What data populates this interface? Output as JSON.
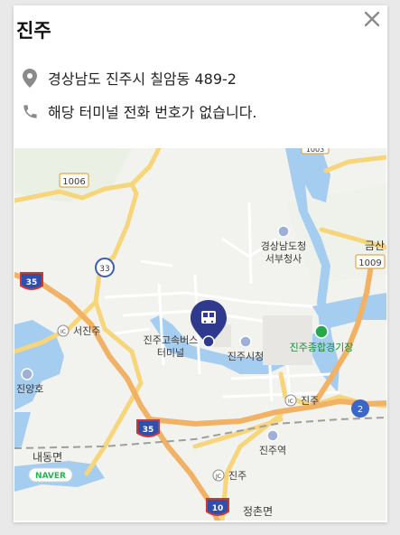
{
  "panel": {
    "title": "진주",
    "close_icon": "close-icon",
    "address": "경상남도 진주시 칠암동 489-2",
    "address_icon": "location-pin-icon",
    "phone": "해당 터미널 전화 번호가 없습니다.",
    "phone_icon": "phone-icon"
  },
  "map": {
    "provider_logo": "NAVER",
    "route_badges": {
      "r1006": "1006",
      "r1009": "1009",
      "r33": "33",
      "r35a": "35",
      "r35b": "35",
      "r10": "10",
      "r2": "2",
      "top": "1003"
    },
    "labels": {
      "gov_office_line1": "경상남도청",
      "gov_office_line2": "서부청사",
      "geumsan": "금산",
      "seojinju": "서진주",
      "bus_terminal_line1": "진주고속버스",
      "bus_terminal_line2": "터미널",
      "city_hall": "진주시청",
      "stadium": "진주종합경기장",
      "jinyangho": "진양호",
      "jinju_ic": "진주",
      "jinju_station": "진주역",
      "naedong": "내동면",
      "jinju_jc": "진주",
      "jeongchon": "정촌면"
    },
    "markers": {
      "ic_badge": "IC",
      "jc_badge": "JC"
    },
    "colors": {
      "water": "#a5cdf0",
      "highway": "#f2b266",
      "main_road": "#f7d57a",
      "marker": "#2f3a8c",
      "naver_green": "#1fb84f"
    }
  }
}
